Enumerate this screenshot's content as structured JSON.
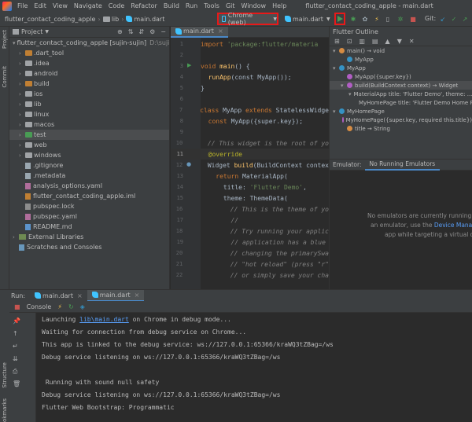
{
  "menubar": {
    "items": [
      "File",
      "Edit",
      "View",
      "Navigate",
      "Code",
      "Refactor",
      "Build",
      "Run",
      "Tools",
      "Git",
      "Window",
      "Help"
    ],
    "window_title": "flutter_contact_coding_apple - main.dart"
  },
  "toolbar": {
    "breadcrumbs": [
      "flutter_contact_coding_apple",
      "lib",
      "main.dart"
    ],
    "device": "Chrome (web)",
    "config": "main.dart",
    "git_label": "Git:"
  },
  "left_stripe": {
    "project": "Project",
    "commit": "Commit"
  },
  "project": {
    "title": "Project",
    "root": "flutter_contact_coding_apple [sujin-sujin]",
    "root_path": "D:\\sujin-sujin",
    "items": [
      {
        "name": ".dart_tool",
        "type": "folder"
      },
      {
        "name": ".idea",
        "type": "folder"
      },
      {
        "name": "android",
        "type": "folder"
      },
      {
        "name": "build",
        "type": "folder"
      },
      {
        "name": "ios",
        "type": "folder"
      },
      {
        "name": "lib",
        "type": "folder"
      },
      {
        "name": "linux",
        "type": "folder"
      },
      {
        "name": "macos",
        "type": "folder"
      },
      {
        "name": "test",
        "type": "folder"
      },
      {
        "name": "web",
        "type": "folder"
      },
      {
        "name": "windows",
        "type": "folder"
      },
      {
        "name": ".gitignore",
        "type": "file"
      },
      {
        "name": ".metadata",
        "type": "file"
      },
      {
        "name": "analysis_options.yaml",
        "type": "yaml"
      },
      {
        "name": "flutter_contact_coding_apple.iml",
        "type": "iml"
      },
      {
        "name": "pubspec.lock",
        "type": "lock"
      },
      {
        "name": "pubspec.yaml",
        "type": "yaml"
      },
      {
        "name": "README.md",
        "type": "md"
      }
    ],
    "external_libraries": "External Libraries",
    "scratches": "Scratches and Consoles"
  },
  "editor": {
    "tab": "main.dart",
    "import_kw": "import",
    "import_str": "'package:flutter/materia",
    "void_kw": "void",
    "main_fn": "main",
    "main_rest": "() {",
    "runapp_fn": "runApp",
    "runapp_rest": "(const MyApp());",
    "close_brace": "}",
    "class_kw": "class",
    "class_name": "MyApp",
    "extends_kw": "extends",
    "extends_name": "StatelessWidge",
    "const_kw": "const",
    "ctor": "MyApp({super.key});",
    "comment1": "// This widget is the root of yo",
    "override": "@override",
    "build_type": "Widget",
    "build_fn": "build",
    "build_rest": "(BuildContext contex",
    "return_kw": "return",
    "material_app": "MaterialApp(",
    "title_key": "title: ",
    "title_val": "'Flutter Demo'",
    "title_comma": ",",
    "theme_key": "theme: ",
    "theme_val": "ThemeData(",
    "comment2": "// This is the theme of yo",
    "comment3": "//",
    "comment4": "// Try running your applic",
    "comment5": "// application has a blue",
    "comment6": "// changing the primarySwa",
    "comment7": "// \"hot reload\" (press \"r\"",
    "comment8": "// or simply save your cha"
  },
  "outline": {
    "title": "Flutter Outline",
    "items": [
      {
        "label": "main() → void",
        "kind": "f",
        "indent": 0
      },
      {
        "label": "MyApp",
        "kind": "c",
        "indent": 1
      },
      {
        "label": "MyApp",
        "kind": "c",
        "indent": 0
      },
      {
        "label": "MyApp({super.key})",
        "kind": "m",
        "indent": 1
      },
      {
        "label": "build(BuildContext context) → Widget",
        "kind": "m",
        "indent": 1
      },
      {
        "label": "MaterialApp title: 'Flutter Demo', theme: ...",
        "kind": "w",
        "indent": 2
      },
      {
        "label": "MyHomePage title: 'Flutter Demo Home P...",
        "kind": "w",
        "indent": 3
      },
      {
        "label": "MyHomePage",
        "kind": "c",
        "indent": 0
      },
      {
        "label": "MyHomePage({super.key, required this.title})",
        "kind": "m",
        "indent": 1
      },
      {
        "label": "title → String",
        "kind": "f",
        "indent": 1
      }
    ]
  },
  "emulator": {
    "label": "Emulator:",
    "tab": "No Running Emulators",
    "line1": "No emulators are currently running.",
    "line2_pre": "an emulator, use the ",
    "line2_link": "Device Manager",
    "line3": "app while targeting a virtual de"
  },
  "run": {
    "label": "Run:",
    "tabs": [
      "main.dart",
      "main.dart"
    ],
    "console_label": "Console",
    "lines": [
      {
        "pre": "Launching ",
        "link": "lib\\main.dart",
        "post": " on Chrome in debug mode..."
      },
      {
        "pre": "Waiting for connection from debug service on Chrome...",
        "link": "",
        "post": ""
      },
      {
        "pre": "This app is linked to the debug service: ws://127.0.0.1:65366/kraWQ3tZBag=/ws",
        "link": "",
        "post": ""
      },
      {
        "pre": "Debug service listening on ws://127.0.0.1:65366/kraWQ3tZBag=/ws",
        "link": "",
        "post": ""
      },
      {
        "pre": "",
        "link": "",
        "post": ""
      },
      {
        "pre": " Running with sound null safety",
        "link": "",
        "post": ""
      },
      {
        "pre": "Debug service listening on ws://127.0.0.1:65366/kraWQ3tZBag=/ws",
        "link": "",
        "post": ""
      },
      {
        "pre": "Flutter Web Bootstrap: Programmatic",
        "link": "",
        "post": ""
      }
    ]
  },
  "bottom_stripe": {
    "structure": "Structure",
    "bookmarks": "Bookmarks"
  }
}
